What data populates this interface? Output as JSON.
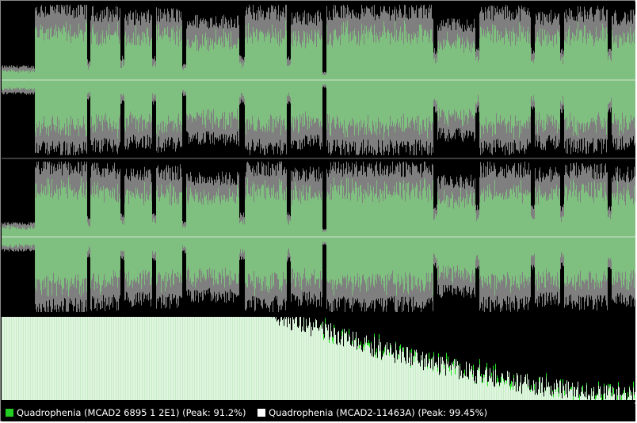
{
  "colors": {
    "background": "#000000",
    "primary": "#7fbf7f",
    "primary_bright": "#22ee22",
    "secondary": "#7f7f7f",
    "secondary_light": "#ffffff",
    "centerline": "#b8d8b8",
    "spectrum_fill": "#dff5df"
  },
  "legend": {
    "entries": [
      {
        "label": "Quadrophenia (MCAD2 6895 1 2E1) (Peak: 91.2%)",
        "color": "#22cc22"
      },
      {
        "label": "Quadrophenia (MCAD2-11463A) (Peak: 99.45%)",
        "color": "#ffffff"
      }
    ]
  }
}
